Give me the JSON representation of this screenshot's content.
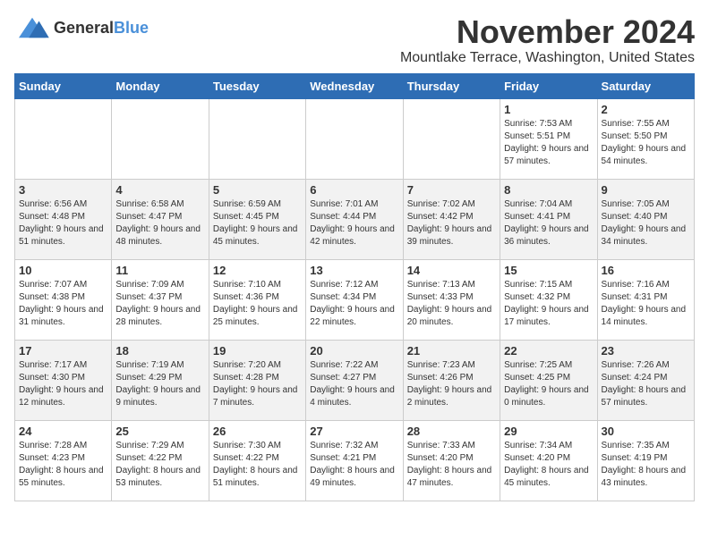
{
  "logo": {
    "general": "General",
    "blue": "Blue"
  },
  "title": "November 2024",
  "location": "Mountlake Terrace, Washington, United States",
  "days_of_week": [
    "Sunday",
    "Monday",
    "Tuesday",
    "Wednesday",
    "Thursday",
    "Friday",
    "Saturday"
  ],
  "weeks": [
    [
      {
        "day": "",
        "content": ""
      },
      {
        "day": "",
        "content": ""
      },
      {
        "day": "",
        "content": ""
      },
      {
        "day": "",
        "content": ""
      },
      {
        "day": "",
        "content": ""
      },
      {
        "day": "1",
        "content": "Sunrise: 7:53 AM\nSunset: 5:51 PM\nDaylight: 9 hours and 57 minutes."
      },
      {
        "day": "2",
        "content": "Sunrise: 7:55 AM\nSunset: 5:50 PM\nDaylight: 9 hours and 54 minutes."
      }
    ],
    [
      {
        "day": "3",
        "content": "Sunrise: 6:56 AM\nSunset: 4:48 PM\nDaylight: 9 hours and 51 minutes."
      },
      {
        "day": "4",
        "content": "Sunrise: 6:58 AM\nSunset: 4:47 PM\nDaylight: 9 hours and 48 minutes."
      },
      {
        "day": "5",
        "content": "Sunrise: 6:59 AM\nSunset: 4:45 PM\nDaylight: 9 hours and 45 minutes."
      },
      {
        "day": "6",
        "content": "Sunrise: 7:01 AM\nSunset: 4:44 PM\nDaylight: 9 hours and 42 minutes."
      },
      {
        "day": "7",
        "content": "Sunrise: 7:02 AM\nSunset: 4:42 PM\nDaylight: 9 hours and 39 minutes."
      },
      {
        "day": "8",
        "content": "Sunrise: 7:04 AM\nSunset: 4:41 PM\nDaylight: 9 hours and 36 minutes."
      },
      {
        "day": "9",
        "content": "Sunrise: 7:05 AM\nSunset: 4:40 PM\nDaylight: 9 hours and 34 minutes."
      }
    ],
    [
      {
        "day": "10",
        "content": "Sunrise: 7:07 AM\nSunset: 4:38 PM\nDaylight: 9 hours and 31 minutes."
      },
      {
        "day": "11",
        "content": "Sunrise: 7:09 AM\nSunset: 4:37 PM\nDaylight: 9 hours and 28 minutes."
      },
      {
        "day": "12",
        "content": "Sunrise: 7:10 AM\nSunset: 4:36 PM\nDaylight: 9 hours and 25 minutes."
      },
      {
        "day": "13",
        "content": "Sunrise: 7:12 AM\nSunset: 4:34 PM\nDaylight: 9 hours and 22 minutes."
      },
      {
        "day": "14",
        "content": "Sunrise: 7:13 AM\nSunset: 4:33 PM\nDaylight: 9 hours and 20 minutes."
      },
      {
        "day": "15",
        "content": "Sunrise: 7:15 AM\nSunset: 4:32 PM\nDaylight: 9 hours and 17 minutes."
      },
      {
        "day": "16",
        "content": "Sunrise: 7:16 AM\nSunset: 4:31 PM\nDaylight: 9 hours and 14 minutes."
      }
    ],
    [
      {
        "day": "17",
        "content": "Sunrise: 7:17 AM\nSunset: 4:30 PM\nDaylight: 9 hours and 12 minutes."
      },
      {
        "day": "18",
        "content": "Sunrise: 7:19 AM\nSunset: 4:29 PM\nDaylight: 9 hours and 9 minutes."
      },
      {
        "day": "19",
        "content": "Sunrise: 7:20 AM\nSunset: 4:28 PM\nDaylight: 9 hours and 7 minutes."
      },
      {
        "day": "20",
        "content": "Sunrise: 7:22 AM\nSunset: 4:27 PM\nDaylight: 9 hours and 4 minutes."
      },
      {
        "day": "21",
        "content": "Sunrise: 7:23 AM\nSunset: 4:26 PM\nDaylight: 9 hours and 2 minutes."
      },
      {
        "day": "22",
        "content": "Sunrise: 7:25 AM\nSunset: 4:25 PM\nDaylight: 9 hours and 0 minutes."
      },
      {
        "day": "23",
        "content": "Sunrise: 7:26 AM\nSunset: 4:24 PM\nDaylight: 8 hours and 57 minutes."
      }
    ],
    [
      {
        "day": "24",
        "content": "Sunrise: 7:28 AM\nSunset: 4:23 PM\nDaylight: 8 hours and 55 minutes."
      },
      {
        "day": "25",
        "content": "Sunrise: 7:29 AM\nSunset: 4:22 PM\nDaylight: 8 hours and 53 minutes."
      },
      {
        "day": "26",
        "content": "Sunrise: 7:30 AM\nSunset: 4:22 PM\nDaylight: 8 hours and 51 minutes."
      },
      {
        "day": "27",
        "content": "Sunrise: 7:32 AM\nSunset: 4:21 PM\nDaylight: 8 hours and 49 minutes."
      },
      {
        "day": "28",
        "content": "Sunrise: 7:33 AM\nSunset: 4:20 PM\nDaylight: 8 hours and 47 minutes."
      },
      {
        "day": "29",
        "content": "Sunrise: 7:34 AM\nSunset: 4:20 PM\nDaylight: 8 hours and 45 minutes."
      },
      {
        "day": "30",
        "content": "Sunrise: 7:35 AM\nSunset: 4:19 PM\nDaylight: 8 hours and 43 minutes."
      }
    ]
  ]
}
